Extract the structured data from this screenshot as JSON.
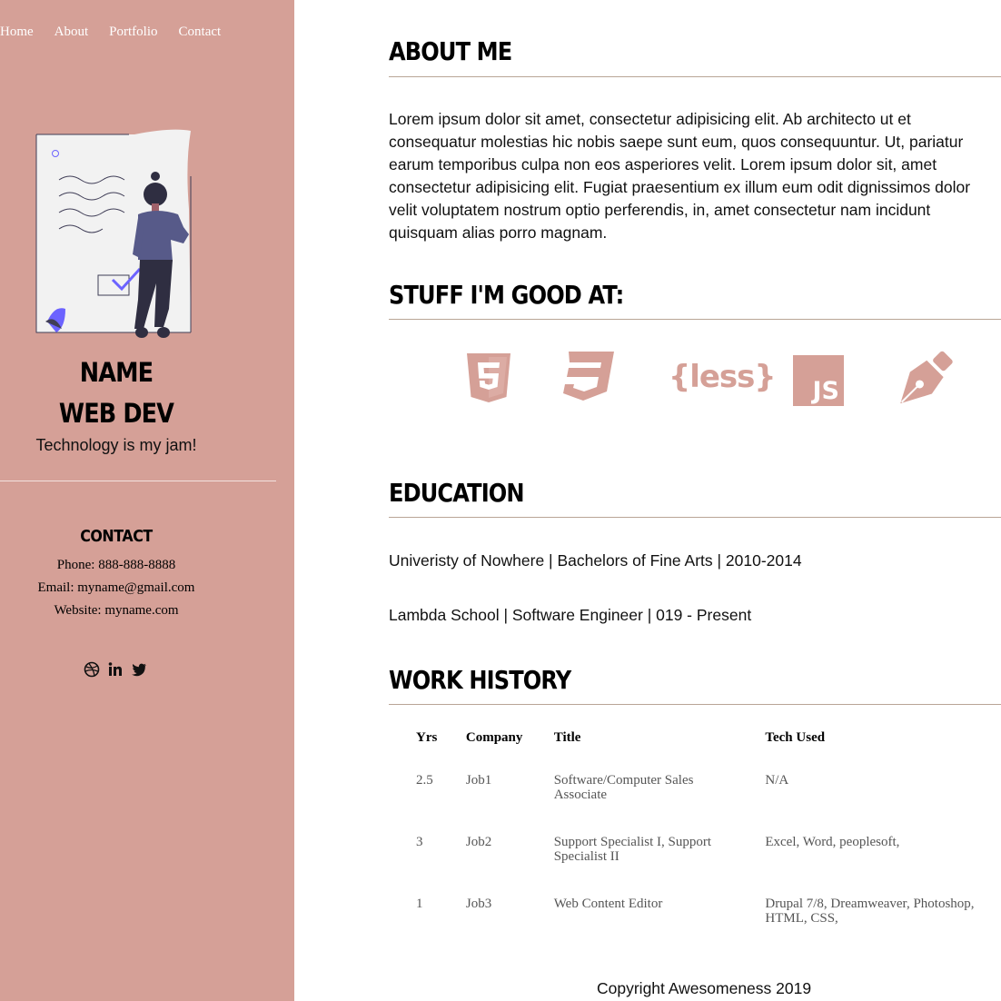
{
  "nav": {
    "items": [
      {
        "label": "Home"
      },
      {
        "label": "About"
      },
      {
        "label": "Portfolio"
      },
      {
        "label": "Contact"
      }
    ]
  },
  "profile": {
    "name": "NAME",
    "role": "WEB DEV",
    "tagline": "Technology is my jam!"
  },
  "contact": {
    "title": "CONTACT",
    "phone": "Phone: 888-888-8888",
    "email": "Email: myname@gmail.com",
    "website": "Website: myname.com",
    "socials": [
      {
        "icon": "dribbble-icon"
      },
      {
        "icon": "linkedin-icon"
      },
      {
        "icon": "twitter-icon"
      }
    ]
  },
  "about": {
    "heading": "ABOUT ME",
    "lines": [
      "Lorem ipsum dolor sit amet, consectetur adipisicing elit. Ab architecto ut et",
      "consequatur molestias hic nobis saepe sunt eum, quos consequuntur. Ut, pariatur",
      "earum temporibus culpa non eos asperiores velit. Lorem ipsum dolor sit, amet",
      "consectetur adipisicing elit. Fugiat praesentium ex illum eum odit dignissimos dolor",
      "velit voluptatem nostrum optio perferendis, in, amet consectetur nam incidunt",
      "quisquam alias porro magnam."
    ]
  },
  "skills": {
    "heading": "STUFF I'M GOOD AT:",
    "items": [
      {
        "icon": "html5-icon"
      },
      {
        "icon": "css3-icon"
      },
      {
        "icon": "less-icon",
        "text": "{less}"
      },
      {
        "icon": "js-icon",
        "text": "JS"
      },
      {
        "icon": "pen-nib-icon"
      }
    ]
  },
  "education": {
    "heading": "EDUCATION",
    "entries": [
      "Univeristy of Nowhere | Bachelors of Fine Arts | 2010-2014",
      "Lambda School | Software Engineer | 019 - Present"
    ]
  },
  "work": {
    "heading": "WORK HISTORY",
    "columns": [
      "Yrs",
      "Company",
      "Title",
      "Tech Used"
    ],
    "rows": [
      {
        "yrs": "2.5",
        "company": "Job1",
        "title": [
          "Software/Computer Sales",
          "Associate"
        ],
        "tech": [
          "N/A"
        ]
      },
      {
        "yrs": "3",
        "company": "Job2",
        "title": [
          "Support Specialist I, Support",
          "Specialist II"
        ],
        "tech": [
          "Excel, Word, peoplesoft,"
        ]
      },
      {
        "yrs": "1",
        "company": "Job3",
        "title": [
          "Web Content Editor"
        ],
        "tech": [
          "Drupal 7/8, Dreamweaver, Photoshop,",
          "HTML, CSS,"
        ]
      }
    ]
  },
  "footer": {
    "text": "Copyright Awesomeness 2019"
  },
  "colors": {
    "sidebar": "#d5a097",
    "accent": "#d5a097",
    "rule": "#b9a596",
    "figure_accent": "#6c63ff"
  }
}
